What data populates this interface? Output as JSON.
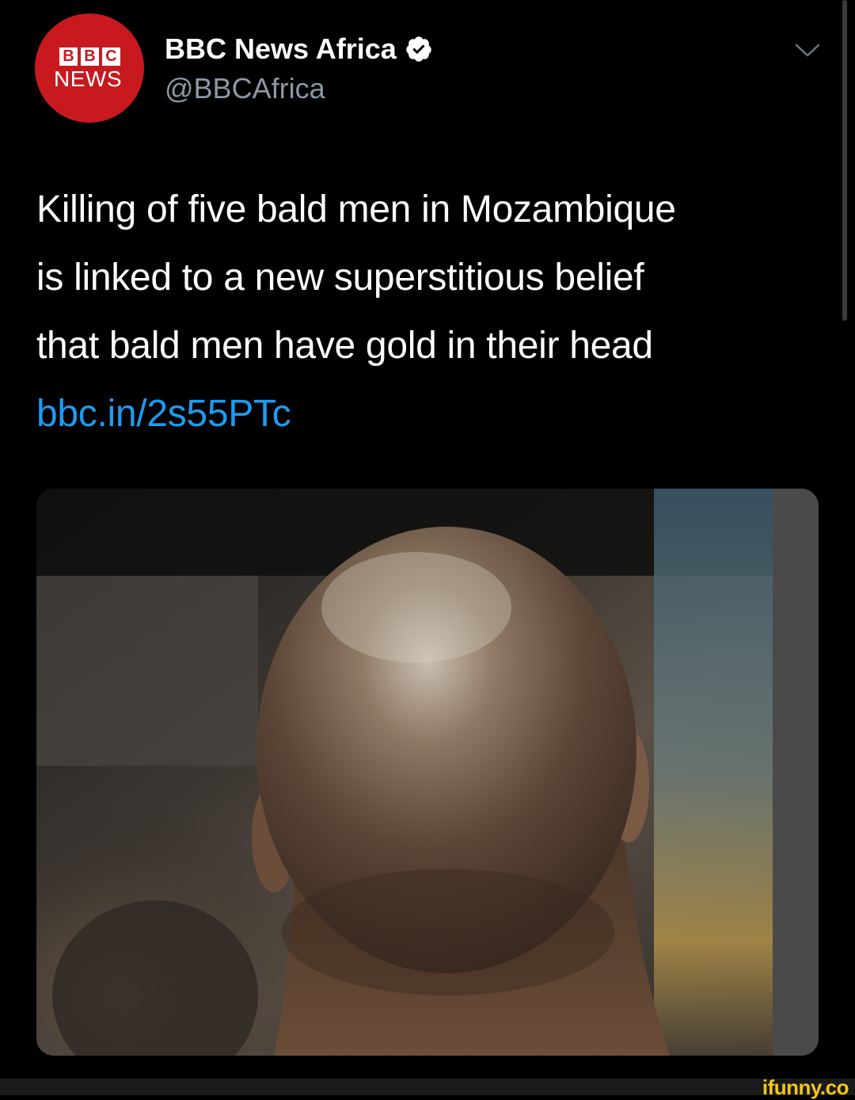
{
  "account": {
    "display_name": "BBC News Africa",
    "handle": "@BBCAfrica",
    "verified": true,
    "avatar_logo": {
      "blocks": [
        "B",
        "B",
        "C"
      ],
      "subtitle": "NEWS"
    }
  },
  "tweet": {
    "text_lines": [
      "Killing of five bald men in Mozambique",
      "is linked to a new superstitious belief",
      "that bald men have gold in their head"
    ],
    "link": "bbc.in/2s55PTc"
  },
  "media": {
    "subject": "photo-back-of-bald-head"
  },
  "watermark": "ifunny.co",
  "colors": {
    "background": "#000000",
    "link": "#1d9bf0",
    "handle": "#8b98a5",
    "avatar_red": "#c8191f",
    "watermark": "#f5c518",
    "verified_badge": "#ffffff"
  },
  "icons": {
    "verified": "verified-badge-icon",
    "menu": "chevron-down-icon"
  }
}
